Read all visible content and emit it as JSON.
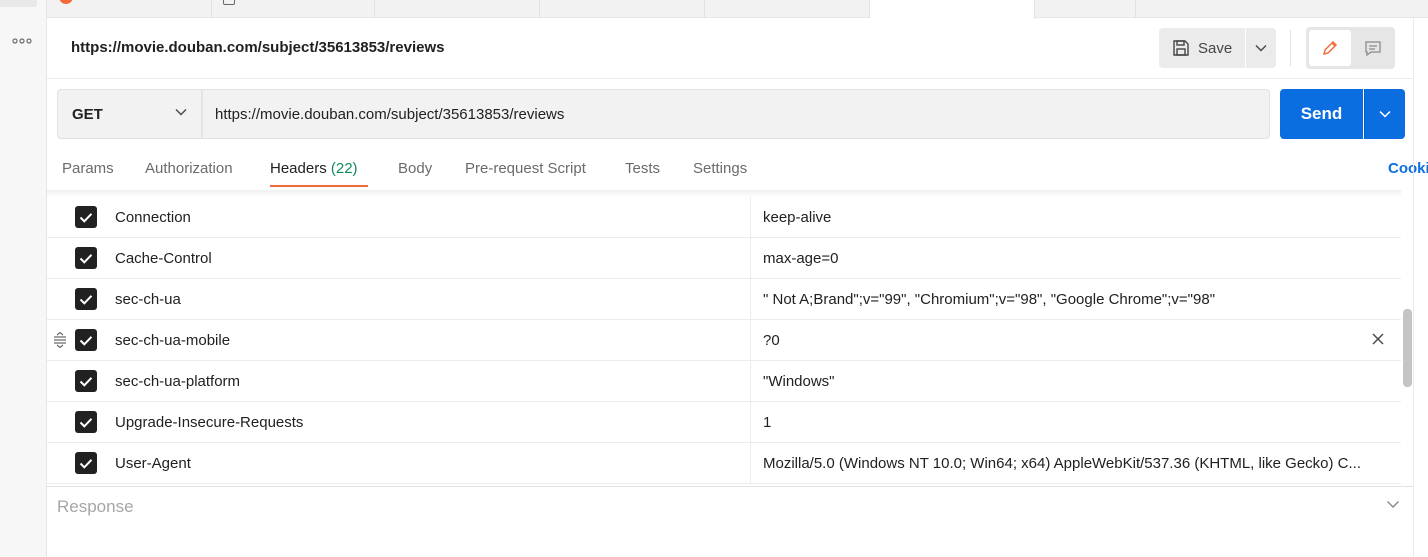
{
  "request": {
    "title_url": "https://movie.douban.com/subject/35613853/reviews",
    "method": "GET",
    "url": "https://movie.douban.com/subject/35613853/reviews"
  },
  "toolbar": {
    "save_label": "Save",
    "send_label": "Send"
  },
  "tabs": [
    {
      "label": "Params"
    },
    {
      "label": "Authorization"
    },
    {
      "label": "Headers",
      "count": "(22)"
    },
    {
      "label": "Body"
    },
    {
      "label": "Pre-request Script"
    },
    {
      "label": "Tests"
    },
    {
      "label": "Settings"
    }
  ],
  "cookies_label": "Cookies",
  "headers": [
    {
      "key": "Connection",
      "value": "keep-alive"
    },
    {
      "key": "Cache-Control",
      "value": "max-age=0"
    },
    {
      "key": "sec-ch-ua",
      "value": "\" Not A;Brand\";v=\"99\", \"Chromium\";v=\"98\", \"Google Chrome\";v=\"98\""
    },
    {
      "key": "sec-ch-ua-mobile",
      "value": "?0"
    },
    {
      "key": "sec-ch-ua-platform",
      "value": "\"Windows\""
    },
    {
      "key": "Upgrade-Insecure-Requests",
      "value": "1"
    },
    {
      "key": "User-Agent",
      "value": "Mozilla/5.0 (Windows NT 10.0; Win64; x64) AppleWebKit/537.36 (KHTML, like Gecko) C..."
    }
  ],
  "response": {
    "label": "Response"
  },
  "colors": {
    "accent": "#f26b3a",
    "primary": "#0b6ee0",
    "count": "#0f8a57"
  },
  "icons": {
    "rail": "more-icon",
    "save": "save-icon",
    "edit": "pencil-icon",
    "comment": "comment-icon",
    "drag": "drag-handle-icon",
    "delete": "close-icon"
  }
}
